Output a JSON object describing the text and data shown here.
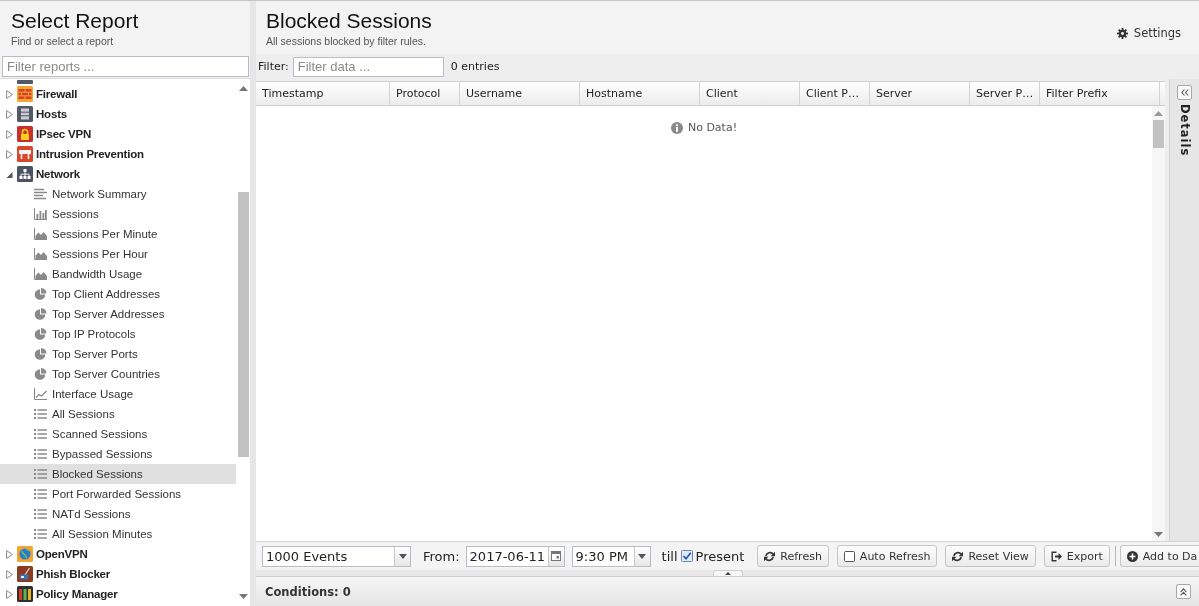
{
  "sidebar": {
    "title": "Select Report",
    "subtitle": "Find or select a report",
    "filter": {
      "placeholder": "Filter reports ..."
    },
    "tree": [
      {
        "label": "Firewall",
        "kind": "firewall",
        "expanded": false,
        "selected": false
      },
      {
        "label": "Hosts",
        "kind": "hosts",
        "expanded": false,
        "selected": false
      },
      {
        "label": "IPsec VPN",
        "kind": "ipsec",
        "expanded": false,
        "selected": false
      },
      {
        "label": "Intrusion Prevention",
        "kind": "intrusion",
        "expanded": false,
        "selected": false
      },
      {
        "label": "Network",
        "kind": "network",
        "expanded": true,
        "selected": false,
        "children": [
          {
            "label": "Network Summary",
            "kind": "text",
            "selected": false
          },
          {
            "label": "Sessions",
            "kind": "bar",
            "selected": false
          },
          {
            "label": "Sessions Per Minute",
            "kind": "area",
            "selected": false
          },
          {
            "label": "Sessions Per Hour",
            "kind": "area",
            "selected": false
          },
          {
            "label": "Bandwidth Usage",
            "kind": "area",
            "selected": false
          },
          {
            "label": "Top Client Addresses",
            "kind": "pie",
            "selected": false
          },
          {
            "label": "Top Server Addresses",
            "kind": "pie",
            "selected": false
          },
          {
            "label": "Top IP Protocols",
            "kind": "pie",
            "selected": false
          },
          {
            "label": "Top Server Ports",
            "kind": "pie",
            "selected": false
          },
          {
            "label": "Top Server Countries",
            "kind": "pie",
            "selected": false
          },
          {
            "label": "Interface Usage",
            "kind": "line",
            "selected": false
          },
          {
            "label": "All Sessions",
            "kind": "list",
            "selected": false
          },
          {
            "label": "Scanned Sessions",
            "kind": "list",
            "selected": false
          },
          {
            "label": "Bypassed Sessions",
            "kind": "list",
            "selected": false
          },
          {
            "label": "Blocked Sessions",
            "kind": "list",
            "selected": true
          },
          {
            "label": "Port Forwarded Sessions",
            "kind": "list",
            "selected": false
          },
          {
            "label": "NATd Sessions",
            "kind": "list",
            "selected": false
          },
          {
            "label": "All Session Minutes",
            "kind": "list",
            "selected": false
          }
        ]
      },
      {
        "label": "OpenVPN",
        "kind": "openvpn",
        "expanded": false,
        "selected": false
      },
      {
        "label": "Phish Blocker",
        "kind": "phish",
        "expanded": false,
        "selected": false
      },
      {
        "label": "Policy Manager",
        "kind": "policy",
        "expanded": false,
        "selected": false
      }
    ]
  },
  "report": {
    "title": "Blocked Sessions",
    "subtitle": "All sessions blocked by filter rules.",
    "settings_button": "Settings",
    "filter": {
      "label": "Filter:",
      "placeholder": "Filter data ...",
      "count": "0 entries"
    },
    "table": {
      "columns": [
        "Timestamp",
        "Protocol",
        "Username",
        "Hostname",
        "Client",
        "Client P…",
        "Server",
        "Server P…",
        "Filter Prefix"
      ],
      "empty_message": "No Data!"
    },
    "details_panel": {
      "title": "Details"
    },
    "toolbar": {
      "limit": {
        "value": "1000 Events"
      },
      "from_label": "From:",
      "date": {
        "value": "2017-06-11"
      },
      "time": {
        "value": "9:30 PM"
      },
      "till_label": "till",
      "present": {
        "label": "Present",
        "checked": true
      },
      "buttons": [
        {
          "label": "Refresh",
          "kind": "refresh",
          "separated": false
        },
        {
          "label": "Auto Refresh",
          "kind": "toggle",
          "checked": false,
          "separated": false
        },
        {
          "label": "Reset View",
          "kind": "refresh",
          "separated": false
        },
        {
          "label": "Export",
          "kind": "export",
          "separated": false
        },
        {
          "label": "Add to Da",
          "kind": "add",
          "separated": true
        }
      ]
    },
    "conditions": {
      "label": "Conditions: 0"
    }
  }
}
